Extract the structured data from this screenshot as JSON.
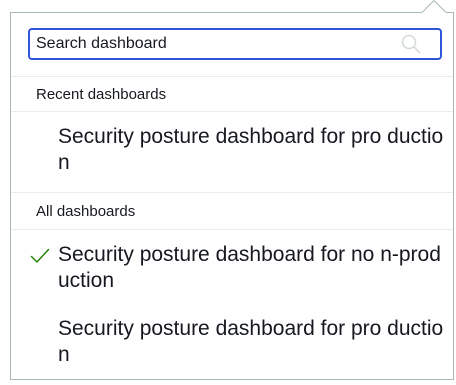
{
  "search": {
    "placeholder": "Search dashboard",
    "value": "",
    "icon": "search-icon"
  },
  "groups": [
    {
      "header": "Recent dashboards",
      "options": [
        {
          "label": "Security posture dashboard for pro duction",
          "selected": false
        }
      ]
    },
    {
      "header": "All dashboards",
      "options": [
        {
          "label": "Security posture dashboard for no n-production",
          "selected": true,
          "icon": "check-icon"
        },
        {
          "label": "Security posture dashboard for pro duction",
          "selected": false
        }
      ]
    }
  ],
  "colors": {
    "focus_border": "#2f56d6",
    "text": "#16191f",
    "divider": "#eaeded",
    "popover_border": "#aab7b8",
    "check": "#1d8102"
  }
}
